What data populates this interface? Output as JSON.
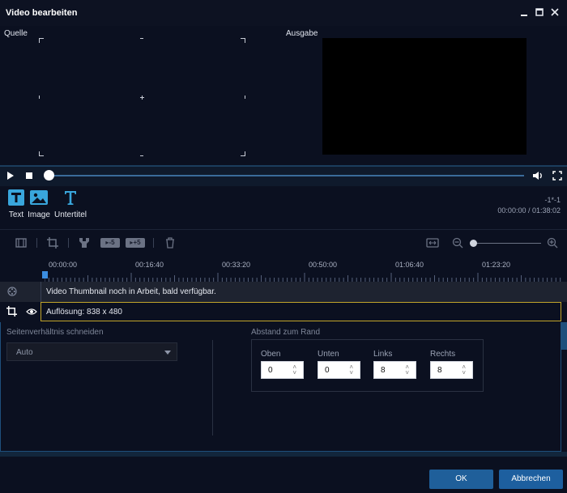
{
  "window": {
    "title": "Video bearbeiten",
    "minimize_icon": "minimize-icon",
    "maximize_icon": "maximize-icon",
    "close_icon": "close-icon"
  },
  "preview": {
    "source_label": "Quelle",
    "output_label": "Ausgabe"
  },
  "playback": {
    "play_icon": "play-icon",
    "stop_icon": "stop-icon",
    "progress": 0.0,
    "volume_icon": "volume-icon",
    "fullscreen_icon": "fullscreen-icon"
  },
  "tools": {
    "text_label": "Text",
    "image_label": "Image",
    "subtitle_label": "Untertitel",
    "frame_info": "-1*-1",
    "time_display": "00:00:00 / 01:38:02"
  },
  "editbar": {
    "slower_label": "▸-5",
    "faster_label": "▸+5",
    "zoom_level": 0.0
  },
  "timeline": {
    "ticks": [
      "00:00:00",
      "00:16:40",
      "00:33:20",
      "00:50:00",
      "01:06:40",
      "01:23:20"
    ],
    "thumbnail_message": "Video Thumbnail noch in Arbeit, bald verfügbar.",
    "resolution_text": "Auflösung: 838 x 480"
  },
  "crop": {
    "aspect_label": "Seitenverhältnis schneiden",
    "aspect_value": "Auto",
    "margin_label": "Abstand zum Rand",
    "fields": [
      {
        "label": "Oben",
        "value": "0"
      },
      {
        "label": "Unten",
        "value": "0"
      },
      {
        "label": "Links",
        "value": "8"
      },
      {
        "label": "Rechts",
        "value": "8"
      }
    ]
  },
  "footer": {
    "ok_label": "OK",
    "cancel_label": "Abbrechen"
  },
  "colors": {
    "background": "#0b1020",
    "accent": "#1f5f9a",
    "selection_border": "#c2a52a",
    "tool_icon": "#39a6dc"
  }
}
